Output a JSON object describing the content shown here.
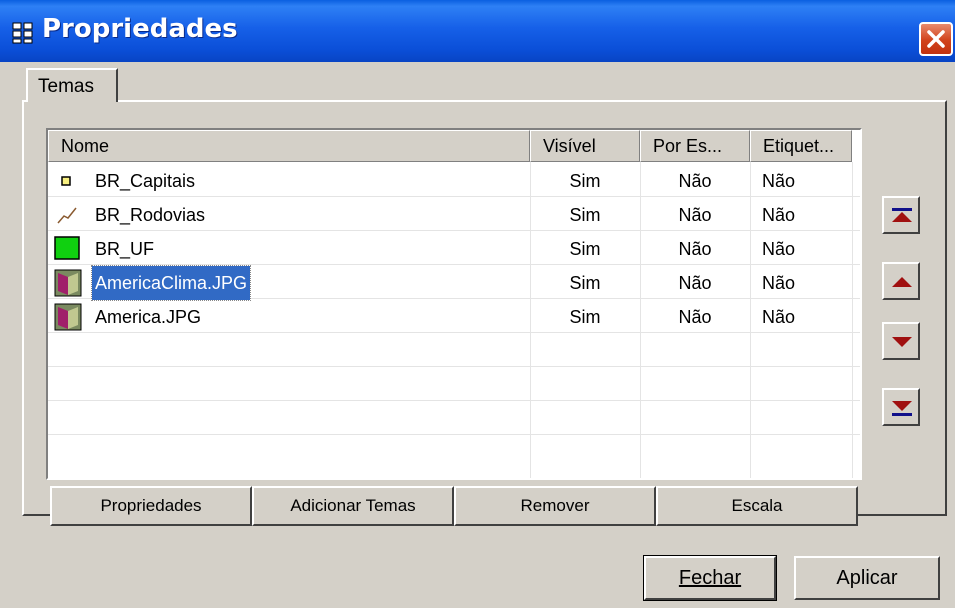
{
  "window": {
    "title": "Propriedades"
  },
  "tabs": [
    {
      "label": "Temas"
    }
  ],
  "table": {
    "columns": [
      "Nome",
      "Visível",
      "Por Es...",
      "Etiquet..."
    ],
    "rows": [
      {
        "icon": "point-layer-icon",
        "name": "BR_Capitais",
        "visivel": "Sim",
        "por_escala": "Não",
        "etiqueta": "Não"
      },
      {
        "icon": "line-layer-icon",
        "name": "BR_Rodovias",
        "visivel": "Sim",
        "por_escala": "Não",
        "etiqueta": "Não"
      },
      {
        "icon": "polygon-layer-icon",
        "name": "BR_UF",
        "visivel": "Sim",
        "por_escala": "Não",
        "etiqueta": "Não"
      },
      {
        "icon": "raster-layer-icon",
        "name": "AmericaClima.JPG",
        "visivel": "Sim",
        "por_escala": "Não",
        "etiqueta": "Não",
        "selected": true
      },
      {
        "icon": "raster-layer-icon",
        "name": "America.JPG",
        "visivel": "Sim",
        "por_escala": "Não",
        "etiqueta": "Não"
      }
    ]
  },
  "buttons": {
    "propriedades": "Propriedades",
    "adicionar_temas": "Adicionar Temas",
    "remover": "Remover",
    "escala": "Escala",
    "fechar": "Fechar",
    "aplicar": "Aplicar"
  },
  "colors": {
    "titlebar": "#0b4fd8",
    "selection": "#316ac5",
    "arrow": "#a01010",
    "close": "#d1421b"
  }
}
